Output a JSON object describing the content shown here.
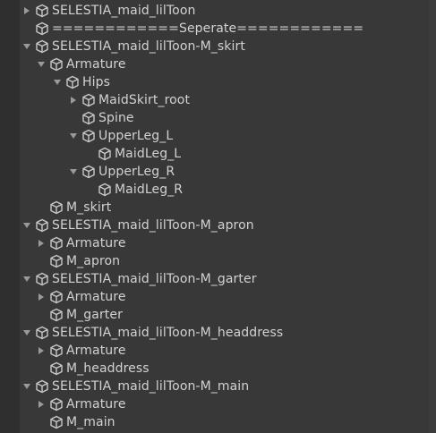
{
  "hierarchy": {
    "rows": [
      {
        "label": "SELESTIA_maid_lilToon",
        "depth": 0,
        "foldout": "collapsed"
      },
      {
        "label": "============Seperate============",
        "depth": 0,
        "foldout": "none"
      },
      {
        "label": "SELESTIA_maid_lilToon-M_skirt",
        "depth": 0,
        "foldout": "expanded"
      },
      {
        "label": "Armature",
        "depth": 1,
        "foldout": "expanded"
      },
      {
        "label": "Hips",
        "depth": 2,
        "foldout": "expanded"
      },
      {
        "label": "MaidSkirt_root",
        "depth": 3,
        "foldout": "collapsed"
      },
      {
        "label": "Spine",
        "depth": 3,
        "foldout": "none"
      },
      {
        "label": "UpperLeg_L",
        "depth": 3,
        "foldout": "expanded"
      },
      {
        "label": "MaidLeg_L",
        "depth": 4,
        "foldout": "none"
      },
      {
        "label": "UpperLeg_R",
        "depth": 3,
        "foldout": "expanded"
      },
      {
        "label": "MaidLeg_R",
        "depth": 4,
        "foldout": "none"
      },
      {
        "label": "M_skirt",
        "depth": 1,
        "foldout": "none"
      },
      {
        "label": "SELESTIA_maid_lilToon-M_apron",
        "depth": 0,
        "foldout": "expanded"
      },
      {
        "label": "Armature",
        "depth": 1,
        "foldout": "collapsed"
      },
      {
        "label": "M_apron",
        "depth": 1,
        "foldout": "none"
      },
      {
        "label": "SELESTIA_maid_lilToon-M_garter",
        "depth": 0,
        "foldout": "expanded"
      },
      {
        "label": "Armature",
        "depth": 1,
        "foldout": "collapsed"
      },
      {
        "label": "M_garter",
        "depth": 1,
        "foldout": "none"
      },
      {
        "label": "SELESTIA_maid_lilToon-M_headdress",
        "depth": 0,
        "foldout": "expanded"
      },
      {
        "label": "Armature",
        "depth": 1,
        "foldout": "collapsed"
      },
      {
        "label": "M_headdress",
        "depth": 1,
        "foldout": "none"
      },
      {
        "label": "SELESTIA_maid_lilToon-M_main",
        "depth": 0,
        "foldout": "expanded"
      },
      {
        "label": "Armature",
        "depth": 1,
        "foldout": "collapsed"
      },
      {
        "label": "M_main",
        "depth": 1,
        "foldout": "none"
      }
    ]
  },
  "icon": "gameobject-cube-icon",
  "colors": {
    "background": "#383838",
    "text": "#d2d2d2",
    "icon": "#c8c8c8",
    "foldout": "#9a9a9a"
  }
}
